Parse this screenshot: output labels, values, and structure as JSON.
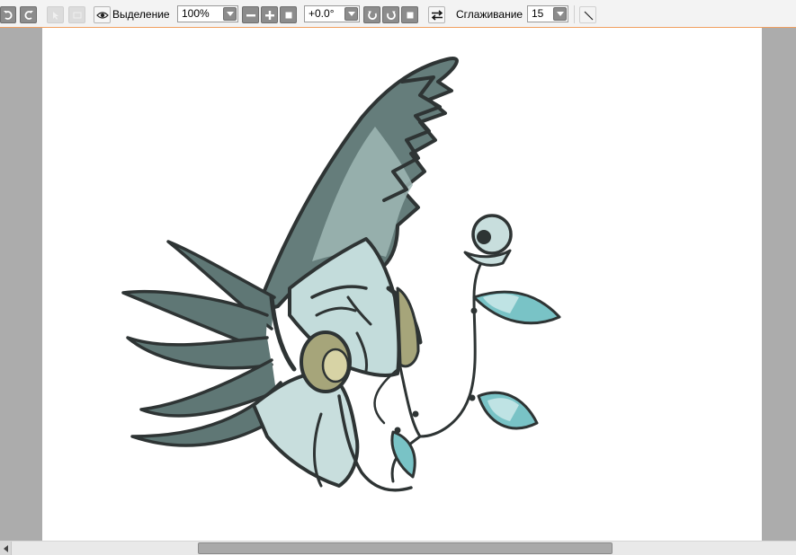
{
  "toolbar": {
    "selection_label": "Выделение",
    "zoom_value": "100%",
    "rotation_value": "+0.0°",
    "smoothing_label": "Сглаживание",
    "smoothing_value": "15"
  },
  "icons": {
    "undo": "undo-icon",
    "redo": "redo-icon",
    "eye": "eye-icon",
    "zoom_out": "minus-icon",
    "zoom_in": "plus-icon",
    "zoom_reset": "square-icon",
    "rotate_ccw": "rotate-ccw-icon",
    "rotate_cw": "rotate-cw-icon",
    "rotate_reset": "square-icon",
    "flip": "flip-arrows-icon",
    "pen": "diagonal-line-icon"
  },
  "colors": {
    "accent_line": "#f0a060",
    "workspace": "#acacac",
    "canvas": "#ffffff",
    "ink": "#2e3434",
    "dark_teal": "#5f7775",
    "light_teal": "#b6d3d1",
    "cyan": "#79c3c6",
    "olive": "#a6a57a"
  }
}
